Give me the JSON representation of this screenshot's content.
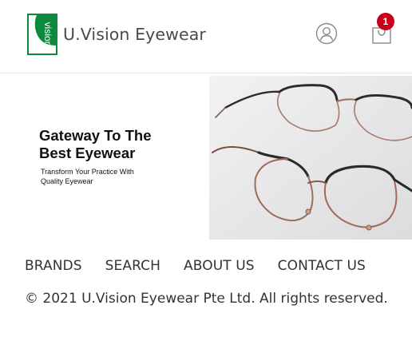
{
  "header": {
    "logo_mark_text": "vision",
    "brand_name": "U.Vision Eyewear",
    "user_icon": "user-icon",
    "cart_icon": "shopping-bag-icon",
    "cart_count": "1"
  },
  "hero": {
    "title_line1": "Gateway To The",
    "title_line2": "Best Eyewear",
    "subtitle_line1": "Transform Your Practice With",
    "subtitle_line2": "Quality Eyewear"
  },
  "footer": {
    "nav": [
      {
        "label": "BRANDS"
      },
      {
        "label": "SEARCH"
      },
      {
        "label": "ABOUT US"
      },
      {
        "label": "CONTACT US"
      }
    ],
    "copyright": "© 2021 U.Vision Eyewear Pte Ltd. All rights reserved."
  },
  "colors": {
    "brand_green": "#0a8a3a",
    "badge_red": "#c8001a",
    "text": "#333333"
  }
}
